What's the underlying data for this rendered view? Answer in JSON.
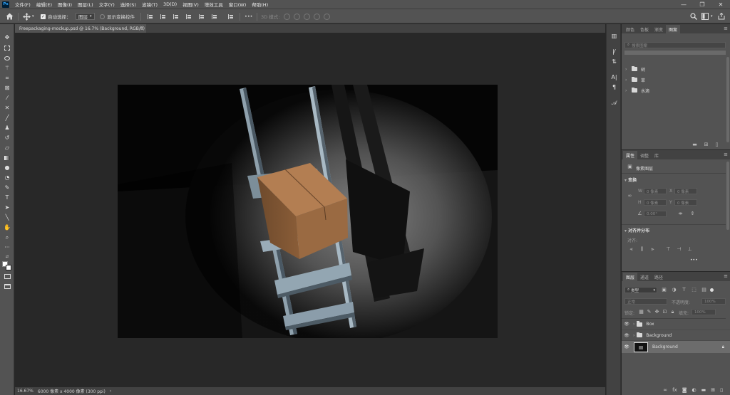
{
  "menu": {
    "app_icon": "Ps",
    "items": [
      "文件(F)",
      "编辑(E)",
      "图像(I)",
      "图层(L)",
      "文字(Y)",
      "选择(S)",
      "滤镜(T)",
      "3D(D)",
      "视图(V)",
      "增效工具",
      "窗口(W)",
      "帮助(H)"
    ],
    "window_controls": [
      "—",
      "❐",
      "✕"
    ]
  },
  "options": {
    "auto_select_label": "自动选择：",
    "auto_select_value": "图层",
    "show_transform_label": "显示变换控件",
    "more": "•••",
    "mode_3d_label": "3D 模式:",
    "icons": [
      "home-icon",
      "move-tool-icon",
      "search-icon",
      "workspace-icon",
      "share-icon"
    ]
  },
  "document": {
    "tab_title": "Freepackaging-mockup.psd @ 16.7% (Background, RGB/8)",
    "close": "×"
  },
  "status": {
    "zoom": "16.67%",
    "dimensions": "6000 像素 x 4000 像素 (300 ppi)",
    "arrow": "›"
  },
  "tools": {
    "icons": [
      "move-icon",
      "marquee-icon",
      "lasso-icon",
      "magic-wand-icon",
      "crop-icon",
      "frame-icon",
      "eyedropper-icon",
      "healing-icon",
      "brush-icon",
      "stamp-icon",
      "history-brush-icon",
      "eraser-icon",
      "gradient-icon",
      "blur-icon",
      "dodge-icon",
      "pen-icon",
      "type-icon",
      "path-select-icon",
      "line-icon",
      "hand-icon",
      "zoom-icon",
      "more-tools-icon",
      "colors-icon",
      "quick-mask-icon",
      "screen-mode-icon"
    ]
  },
  "swatches_panel": {
    "tabs": [
      "颜色",
      "色板",
      "渐变",
      "图案"
    ],
    "active_tab": "图案",
    "search_placeholder": "搜索图案",
    "folders": [
      "树",
      "草",
      "水滴"
    ]
  },
  "properties_panel": {
    "tabs": [
      "属性",
      "调整",
      "库"
    ],
    "layer_kind": "像素图层",
    "transform_title": "变换",
    "w_label": "W",
    "w_value": "0 像素",
    "x_label": "X",
    "x_value": "0 像素",
    "h_label": "H",
    "h_value": "0 像素",
    "y_label": "Y",
    "y_value": "0 像素",
    "angle_value": "0.00°",
    "align_title": "对齐并分布",
    "align_label": "对齐:",
    "more": "•••"
  },
  "layers_panel": {
    "tabs": [
      "图层",
      "通道",
      "路径"
    ],
    "filter_kind": "类型",
    "blend_mode": "正常",
    "opacity_label": "不透明度:",
    "opacity_value": "100%",
    "lock_label": "锁定:",
    "fill_label": "填充:",
    "fill_value": "100%",
    "layers": [
      {
        "name": "Box",
        "type": "group",
        "visible": true,
        "selected": false
      },
      {
        "name": "Background",
        "type": "group",
        "visible": true,
        "selected": false
      },
      {
        "name": "Background",
        "type": "pixel",
        "visible": true,
        "selected": true,
        "locked": true
      }
    ],
    "footer_icons": [
      "link-icon",
      "fx-icon",
      "mask-icon",
      "adjustment-icon",
      "group-icon",
      "new-layer-icon",
      "trash-icon"
    ]
  },
  "colors": {
    "chrome": "#535353",
    "panel_dark": "#424242",
    "workspace": "#282828",
    "accent": "#31a8ff",
    "selected_layer": "#6c6c6c"
  }
}
